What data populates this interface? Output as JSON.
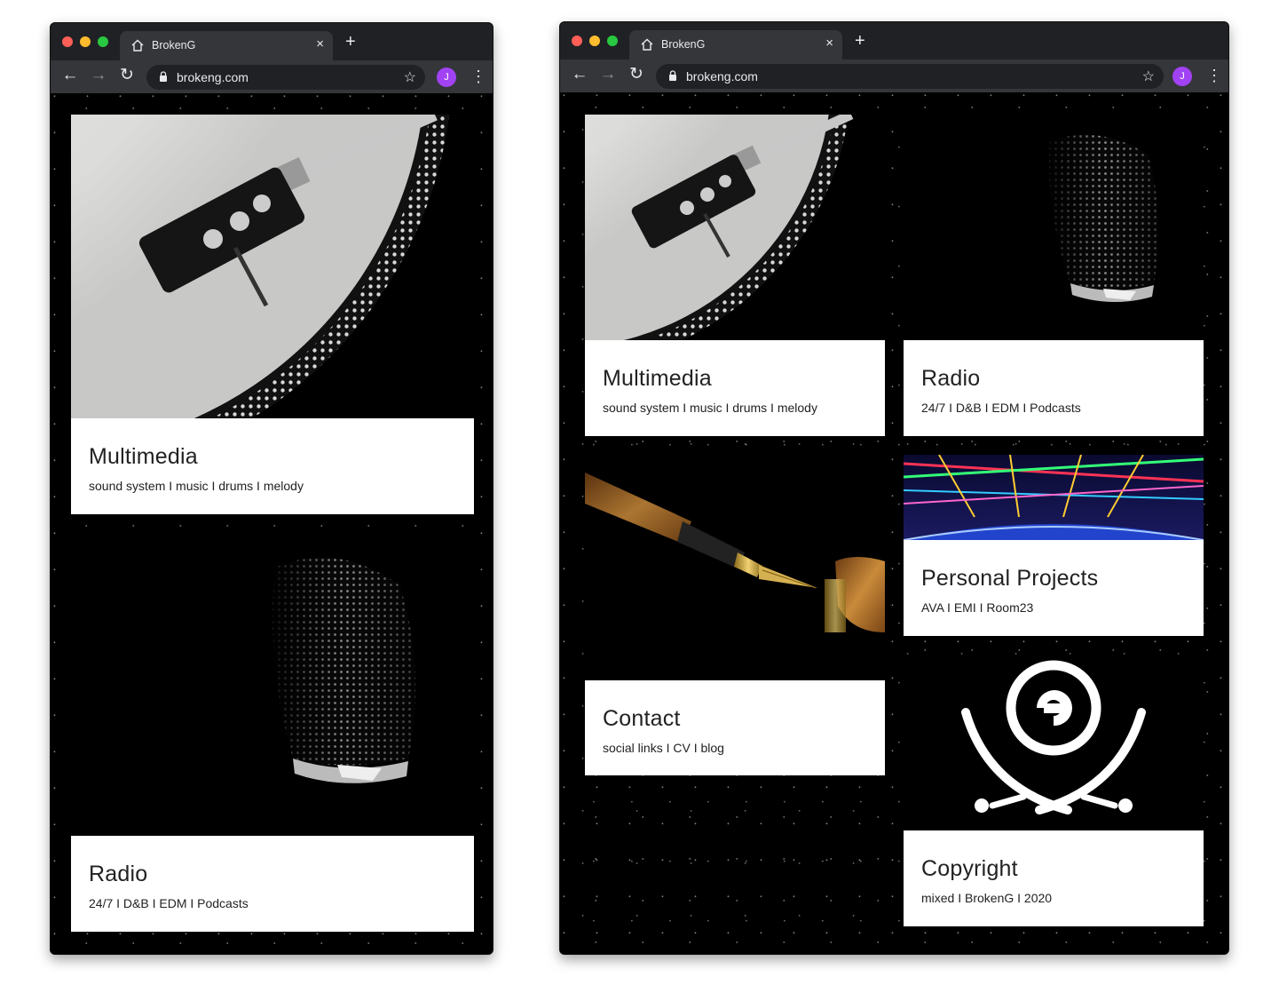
{
  "browser": {
    "tab_title": "BrokenG",
    "tab_close": "×",
    "new_tab": "+",
    "url": "brokeng.com",
    "avatar_initial": "J",
    "back": "←",
    "forward": "→",
    "reload": "↻",
    "star": "☆",
    "menu": "⋮",
    "icons": [
      "home-icon",
      "lock-icon",
      "star-icon",
      "kebab-menu-icon"
    ]
  },
  "cards": {
    "multimedia": {
      "title": "Multimedia",
      "subtitle": "sound system I music I drums I melody"
    },
    "radio": {
      "title": "Radio",
      "subtitle": "24/7 I D&B I EDM I Podcasts"
    },
    "contact": {
      "title": "Contact",
      "subtitle": "social links I CV I blog"
    },
    "projects": {
      "title": "Personal Projects",
      "subtitle": "AVA I EMI I Room23"
    },
    "copyright": {
      "title": "Copyright",
      "subtitle": "mixed I BrokenG I 2020"
    }
  },
  "colors": {
    "chrome_dark": "#202124",
    "chrome_toolbar": "#35363a",
    "avatar": "#a142f4",
    "page_bg": "#000000",
    "card_text_bg": "#ffffff"
  }
}
